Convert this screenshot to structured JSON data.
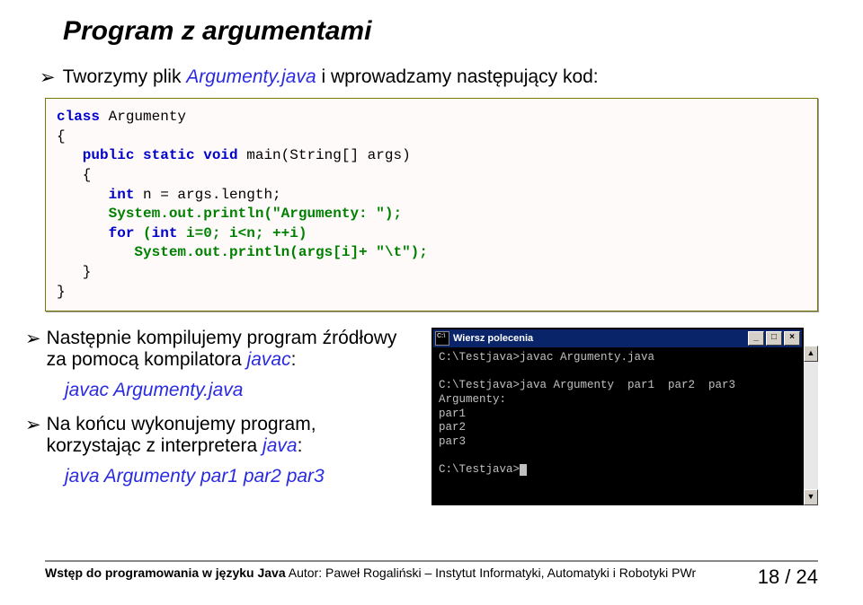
{
  "title": "Program z argumentami",
  "line1_pre": "Tworzymy plik ",
  "line1_file": "Argumenty.java",
  "line1_post": "  i wprowadzamy następujący kod:",
  "code": {
    "l1a": "class",
    "l1b": " Argumenty",
    "l2": "{",
    "l3a": "   public static void",
    "l3b": " main(String[] args)",
    "l4": "   {",
    "l5a": "      int",
    "l5b": " n = args.length;",
    "l6": "      System.out.println(\"Argumenty: \");",
    "l7a": "      for",
    "l7b": " (",
    "l7c": "int",
    "l7d": " i=0; i<n; ++i)",
    "l8": "         System.out.println(args[i]+ \"\\t\");",
    "l9": "   }",
    "l10": "}"
  },
  "b2a": "Następnie kompilujemy program źródłowy",
  "b2b": "za pomocą kompilatora ",
  "b2c": "javac",
  "b2d": ":",
  "cmd1": "javac  Argumenty.java",
  "b3a": "Na końcu wykonujemy program,",
  "b3b": "korzystając z interpretera ",
  "b3c": "java",
  "b3d": ":",
  "cmd2": "java  Argumenty  par1  par2  par3",
  "console": {
    "title": "Wiersz polecenia",
    "line1": "C:\\Testjava>javac Argumenty.java",
    "line2": "",
    "line3": "C:\\Testjava>java Argumenty  par1  par2  par3",
    "line4": "Argumenty:",
    "line5": "par1",
    "line6": "par2",
    "line7": "par3",
    "line8": "",
    "line9_prompt": "C:\\Testjava>"
  },
  "footer_left": "Wstęp do programowania w języku Java",
  "footer_mid": "   Autor: Paweł Rogaliński – Instytut Informatyki, Automatyki i Robotyki PWr",
  "footer_right": "18 / 24"
}
